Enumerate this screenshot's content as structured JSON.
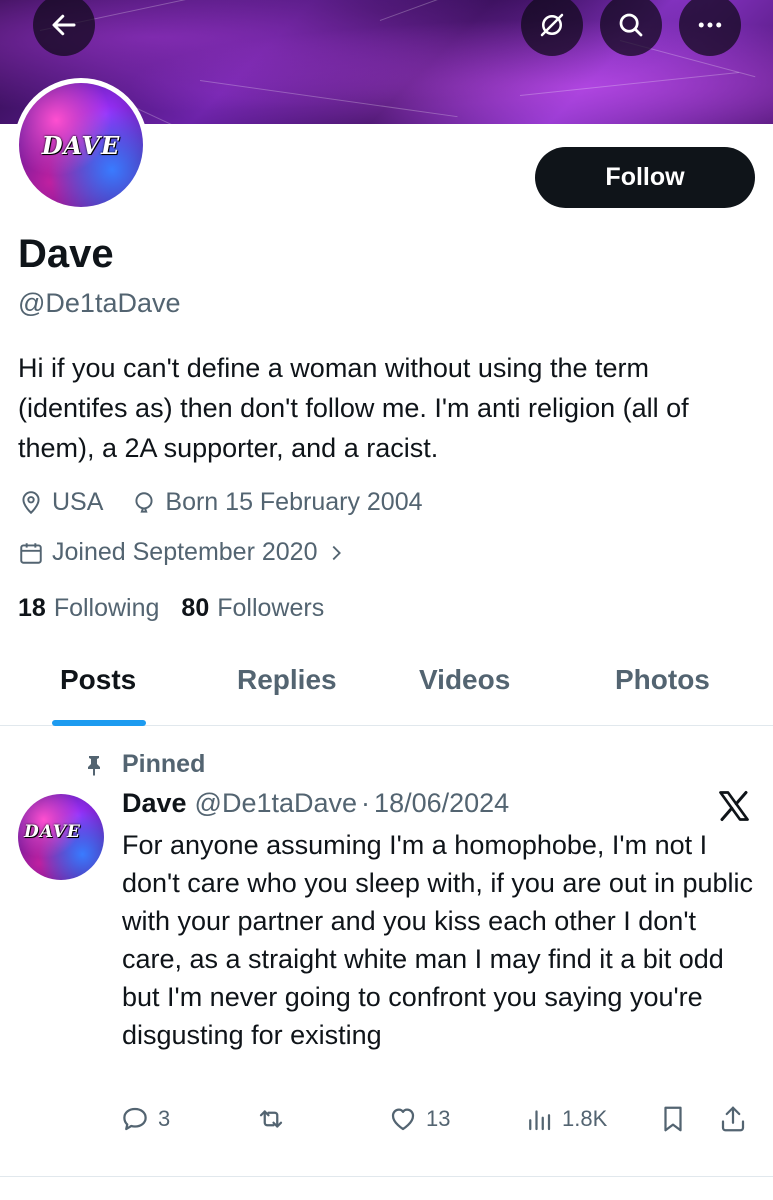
{
  "header": {
    "back_icon": "arrow-left-icon",
    "grok_icon": "grok-icon",
    "search_icon": "search-icon",
    "more_icon": "more-dots-icon"
  },
  "avatar": {
    "logo_text": "DAVE"
  },
  "follow_label": "Follow",
  "profile": {
    "name": "Dave",
    "handle": "@De1taDave",
    "bio": "Hi if you can't define a woman without using the term (identifes as) then don't follow me. I'm anti religion (all of them), a 2A supporter, and a racist.",
    "location": "USA",
    "birthday": "Born 15 February 2004",
    "joined": "Joined September 2020",
    "following_count": "18",
    "following_label": "Following",
    "followers_count": "80",
    "followers_label": "Followers"
  },
  "tabs": [
    {
      "label": "Posts",
      "active": true
    },
    {
      "label": "Replies",
      "active": false
    },
    {
      "label": "Videos",
      "active": false
    },
    {
      "label": "Photos",
      "active": false
    }
  ],
  "post": {
    "pinned_label": "Pinned",
    "author_name": "Dave",
    "author_handle": "@De1taDave",
    "separator": "·",
    "date": "18/06/2024",
    "text": "For anyone assuming I'm a homophobe, I'm not I don't care who you sleep with, if you are out in public with your partner and you kiss each other I don't care, as a straight white man I may find it a bit odd but I'm never going to confront you saying you're disgusting for existing",
    "replies": "3",
    "reposts": "",
    "likes": "13",
    "views": "1.8K"
  },
  "colors": {
    "accent": "#1d9bf0",
    "text_primary": "#0f1419",
    "text_secondary": "#536471",
    "follow_bg": "#0f1419"
  }
}
